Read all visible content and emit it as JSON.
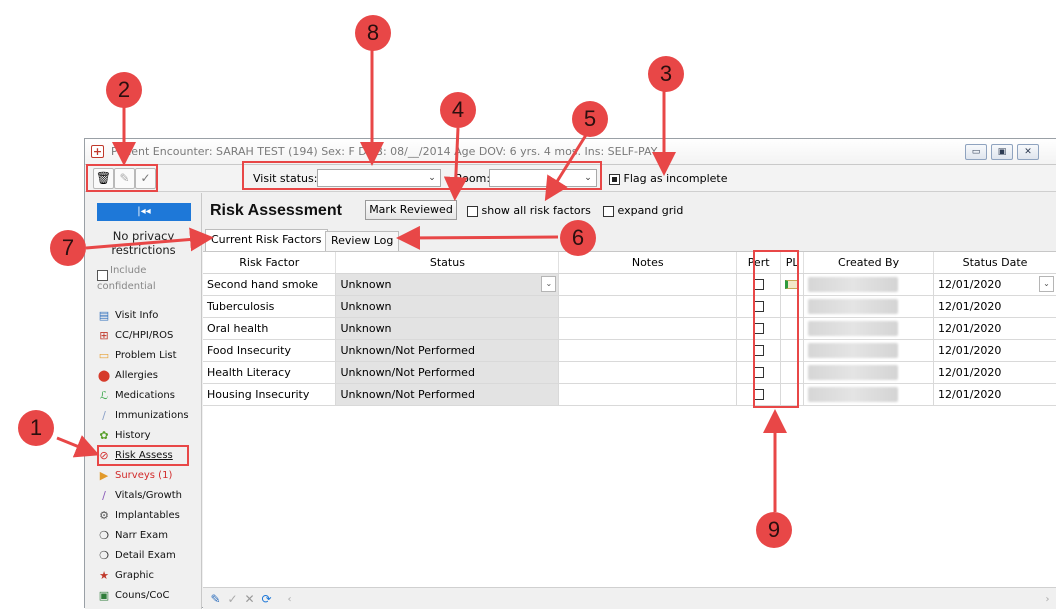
{
  "window": {
    "title": "Patient Encounter: SARAH TEST (194)  Sex: F  DOB: 08/__/2014  Age DOV: 6 yrs. 4 mos.  Ins: SELF-PAY",
    "controls": [
      "▭",
      "▣",
      "✕"
    ]
  },
  "toolbar": {
    "visit_status_label": "Visit status:",
    "visit_status_value": "",
    "room_label": "Room:",
    "room_value": "",
    "flag_incomplete_label": "Flag as incomplete"
  },
  "sidebar": {
    "collapse_glyph": "|◂◂",
    "privacy_text": "No privacy restrictions",
    "include_confidential": "Include confidential",
    "items": [
      {
        "label": "Visit Info",
        "icon": "visit-info-icon"
      },
      {
        "label": "CC/HPI/ROS",
        "icon": "cc-hpi-icon"
      },
      {
        "label": "Problem List",
        "icon": "problem-list-icon"
      },
      {
        "label": "Allergies",
        "icon": "allergies-icon"
      },
      {
        "label": "Medications",
        "icon": "medications-icon"
      },
      {
        "label": "Immunizations",
        "icon": "immunizations-icon"
      },
      {
        "label": "History",
        "icon": "history-icon"
      },
      {
        "label": "Risk Assess",
        "icon": "risk-assess-icon"
      },
      {
        "label": "Surveys (1)",
        "icon": "surveys-icon"
      },
      {
        "label": "Vitals/Growth",
        "icon": "vitals-icon"
      },
      {
        "label": "Implantables",
        "icon": "implantables-icon"
      },
      {
        "label": "Narr Exam",
        "icon": "narr-exam-icon"
      },
      {
        "label": "Detail Exam",
        "icon": "detail-exam-icon"
      },
      {
        "label": "Graphic",
        "icon": "graphic-icon"
      },
      {
        "label": "Couns/CoC",
        "icon": "couns-icon"
      }
    ]
  },
  "main": {
    "title": "Risk Assessment",
    "mark_reviewed": "Mark Reviewed",
    "show_all_label": "show all risk factors",
    "expand_grid_label": "expand grid",
    "tabs": [
      "Current Risk Factors",
      "Review Log"
    ],
    "columns": [
      "Risk Factor",
      "Status",
      "Notes",
      "Pert",
      "PL",
      "Created By",
      "Status Date"
    ],
    "rows": [
      {
        "factor": "Second hand smoke",
        "status": "Unknown",
        "date": "12/01/2020"
      },
      {
        "factor": "Tuberculosis",
        "status": "Unknown",
        "date": "12/01/2020"
      },
      {
        "factor": "Oral health",
        "status": "Unknown",
        "date": "12/01/2020"
      },
      {
        "factor": "Food Insecurity",
        "status": "Unknown/Not Performed",
        "date": "12/01/2020"
      },
      {
        "factor": "Health Literacy",
        "status": "Unknown/Not Performed",
        "date": "12/01/2020"
      },
      {
        "factor": "Housing Insecurity",
        "status": "Unknown/Not Performed",
        "date": "12/01/2020"
      }
    ]
  },
  "annotations": [
    "1",
    "2",
    "3",
    "4",
    "5",
    "6",
    "7",
    "8",
    "9"
  ],
  "colors": {
    "callout": "#e84747",
    "sidebar_button": "#1e78d8"
  }
}
